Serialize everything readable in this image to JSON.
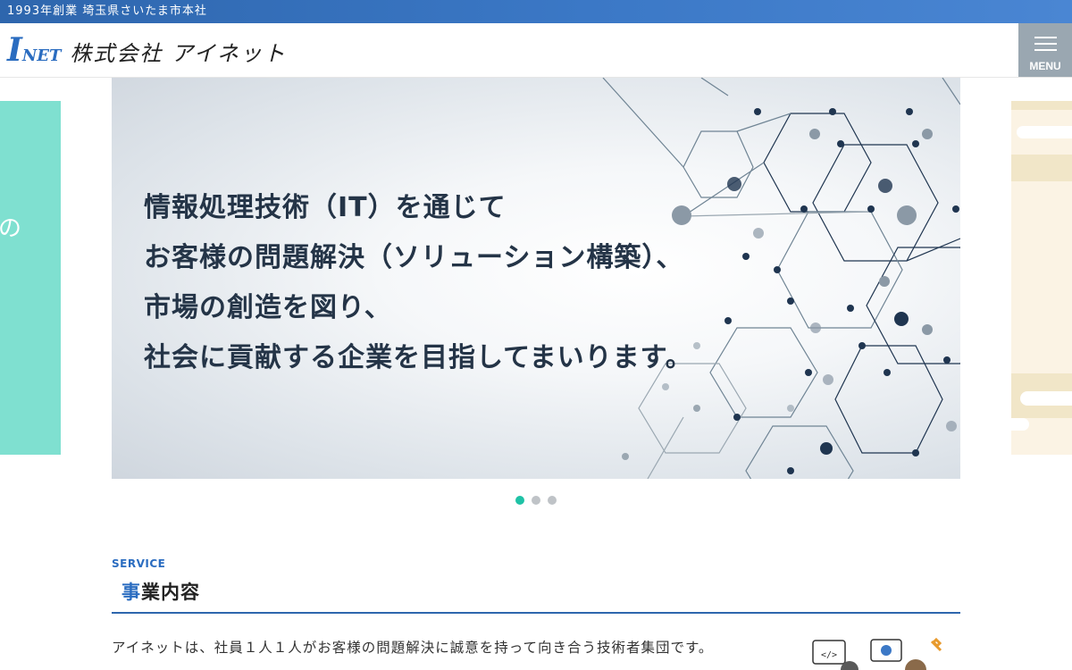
{
  "topbar": {
    "text": "1993年創業 埼玉県さいたま市本社"
  },
  "header": {
    "logo_mark_big": "I",
    "logo_mark_small": "NET",
    "company_name": "株式会社 アイネット",
    "menu_label": "MENU"
  },
  "carousel": {
    "prev_slide_text": "の",
    "lines": [
      "情報処理技術（IT）を通じて",
      "お客様の問題解決（ソリューション構築）、",
      "市場の創造を図り、",
      "社会に貢献する企業を目指してまいります。"
    ],
    "dot_count": 3,
    "active_dot": 1
  },
  "service": {
    "label_en": "SERVICE",
    "title_accent": "事",
    "title_rest": "業内容",
    "description": "アイネットは、社員１人１人がお客様の問題解決に誠意を持って向き合う技術者集団です。"
  },
  "colors": {
    "brand_blue": "#2a6cc0",
    "prev_slide": "#7fe0d0",
    "next_slide": "#fbf3e4",
    "dot_active": "#1fc2a6",
    "menu_bg": "#9aa7b1"
  }
}
